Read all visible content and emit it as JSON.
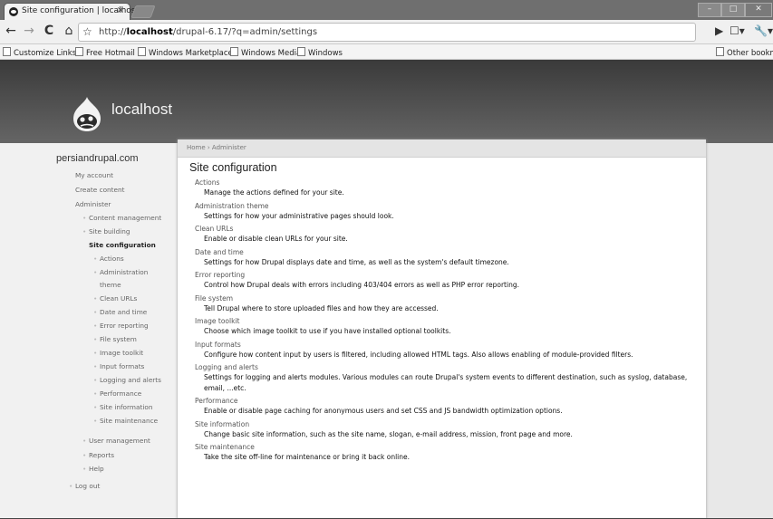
{
  "tab": {
    "title": "Site configuration | localhost",
    "close": "×"
  },
  "window_controls": [
    "–",
    "□",
    "✕"
  ],
  "toolbar": {
    "back": "←",
    "forward": "→",
    "reload": "C",
    "home": "⌂",
    "star": "☆",
    "url_prefix": "http://",
    "url_host": "localhost",
    "url_path": "/drupal-6.17/?q=admin/settings",
    "page_menu": "▶",
    "doc_menu": "☐▾",
    "wrench_menu": "🔧▾"
  },
  "bookmarks": {
    "items": [
      "Customize Links",
      "Free Hotmail",
      "Windows Marketplace",
      "Windows Media",
      "Windows"
    ],
    "other": "Other bookmarks"
  },
  "site": {
    "name": "localhost"
  },
  "breadcrumb": "Home › Administer",
  "page_title": "Site configuration",
  "sidebar": {
    "title": "persiandrupal.com",
    "items": [
      {
        "label": "My account"
      },
      {
        "label": "Create content"
      },
      {
        "label": "Administer"
      },
      {
        "label": "Content management"
      },
      {
        "label": "Site building"
      },
      {
        "label": "Site configuration"
      },
      {
        "label": "Actions"
      },
      {
        "label": "Administration"
      },
      {
        "label": "theme"
      },
      {
        "label": "Clean URLs"
      },
      {
        "label": "Date and time"
      },
      {
        "label": "Error reporting"
      },
      {
        "label": "File system"
      },
      {
        "label": "Image toolkit"
      },
      {
        "label": "Input formats"
      },
      {
        "label": "Logging and alerts"
      },
      {
        "label": "Performance"
      },
      {
        "label": "Site information"
      },
      {
        "label": "Site maintenance"
      },
      {
        "label": "User management"
      },
      {
        "label": "Reports"
      },
      {
        "label": "Help"
      },
      {
        "label": "Log out"
      }
    ]
  },
  "settings": [
    {
      "title": "Actions",
      "desc": "Manage the actions defined for your site."
    },
    {
      "title": "Administration theme",
      "desc": "Settings for how your administrative pages should look."
    },
    {
      "title": "Clean URLs",
      "desc": "Enable or disable clean URLs for your site."
    },
    {
      "title": "Date and time",
      "desc": "Settings for how Drupal displays date and time, as well as the system's default timezone."
    },
    {
      "title": "Error reporting",
      "desc": "Control how Drupal deals with errors including 403/404 errors as well as PHP error reporting."
    },
    {
      "title": "File system",
      "desc": "Tell Drupal where to store uploaded files and how they are accessed."
    },
    {
      "title": "Image toolkit",
      "desc": "Choose which image toolkit to use if you have installed optional toolkits."
    },
    {
      "title": "Input formats",
      "desc": "Configure how content input by users is filtered, including allowed HTML tags. Also allows enabling of module-provided filters."
    },
    {
      "title": "Logging and alerts",
      "desc": "Settings for logging and alerts modules. Various modules can route Drupal's system events to different destination, such as syslog, database, email, ...etc."
    },
    {
      "title": "Performance",
      "desc": "Enable or disable page caching for anonymous users and set CSS and JS bandwidth optimization options."
    },
    {
      "title": "Site information",
      "desc": "Change basic site information, such as the site name, slogan, e-mail address, mission, front page and more."
    },
    {
      "title": "Site maintenance",
      "desc": "Take the site off-line for maintenance or bring it back online."
    }
  ]
}
